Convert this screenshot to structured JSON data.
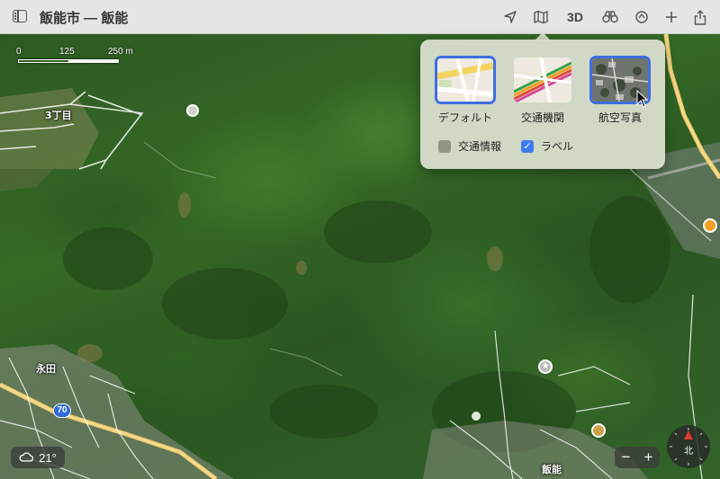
{
  "window": {
    "title": "飯能市 — 飯能"
  },
  "toolbar": {
    "sidebar_icon": "sidebar-icon",
    "location_icon": "location-arrow-icon",
    "map_icon": "map-icon",
    "three_d_label": "3D",
    "binoculars_icon": "binoculars-icon",
    "rotate_icon": "rotate-icon",
    "add_icon": "plus-icon",
    "share_icon": "share-icon"
  },
  "map_style_popover": {
    "options": [
      {
        "label": "デフォルト",
        "selected": false
      },
      {
        "label": "交通機関",
        "selected": false
      },
      {
        "label": "航空写真",
        "selected": true
      }
    ],
    "checkboxes": [
      {
        "label": "交通情報",
        "checked": false
      },
      {
        "label": "ラベル",
        "checked": true
      }
    ],
    "accent_color": "#3d6fe0"
  },
  "scale": {
    "labels": [
      "0",
      "125",
      "250 m"
    ]
  },
  "map_labels": {
    "district": "3丁目",
    "area": "永田",
    "station_area": "飯能",
    "route": "70"
  },
  "weather": {
    "icon": "cloud-icon",
    "temperature": "21°"
  },
  "zoom": {
    "minus": "−",
    "plus": "+"
  },
  "compass": {
    "label": "北"
  }
}
